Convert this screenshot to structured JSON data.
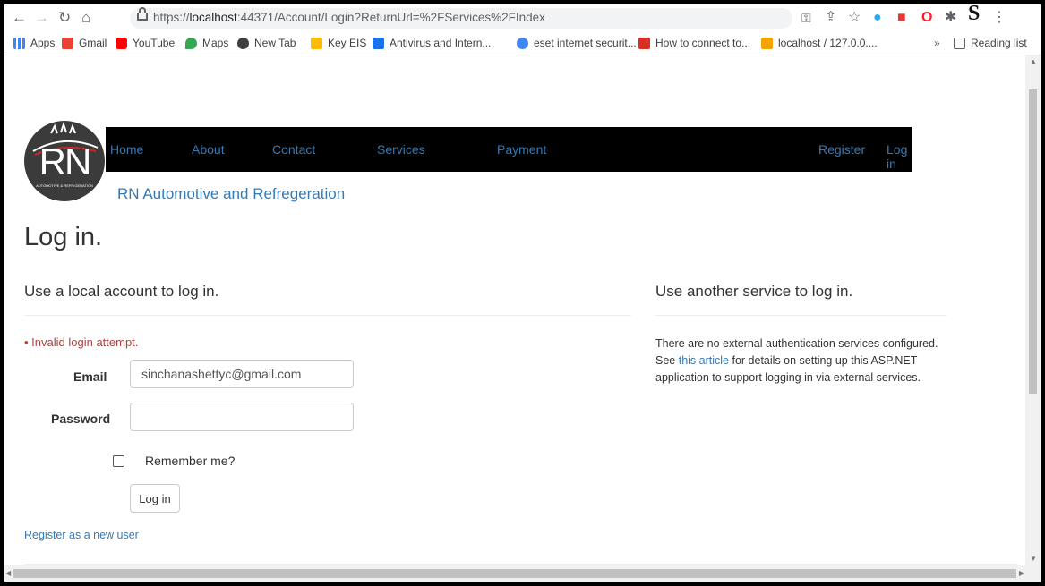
{
  "browser": {
    "url_prefix": "https://",
    "url_host": "localhost",
    "url_rest": ":44371/Account/Login?ReturnUrl=%2FServices%2FIndex",
    "profile_letter": "S"
  },
  "bookmarks": [
    {
      "label": "Apps",
      "color": "#4285f4"
    },
    {
      "label": "Gmail",
      "color": "#ea4335"
    },
    {
      "label": "YouTube",
      "color": "#ff0000"
    },
    {
      "label": "Maps",
      "color": "#34a853"
    },
    {
      "label": "New Tab",
      "color": "#3c4043"
    },
    {
      "label": "Key EIS",
      "color": "#fbbc05"
    },
    {
      "label": "Antivirus and Intern...",
      "color": "#1a73e8"
    },
    {
      "label": "eset internet securit...",
      "color": "#4285f4"
    },
    {
      "label": "How to connect to...",
      "color": "#d93025"
    },
    {
      "label": "localhost / 127.0.0....",
      "color": "#f4a300"
    }
  ],
  "reading_list": "Reading list",
  "overflow": "»",
  "logo": {
    "initials": "RN",
    "tagline": "AUTOMOTIVE & REFRIGERATION"
  },
  "nav": {
    "home": "Home",
    "about": "About",
    "contact": "Contact",
    "services": "Services",
    "payment": "Payment",
    "register": "Register",
    "login": "Log in"
  },
  "brand": "RN Automotive and Refregeration",
  "page_title": "Log in.",
  "local": {
    "heading": "Use a local account to log in.",
    "error": "Invalid login attempt.",
    "email_label": "Email",
    "email_value": "sinchanashettyc@gmail.com",
    "password_label": "Password",
    "password_value": "",
    "remember_label": "Remember me?",
    "login_button": "Log in",
    "register_link": "Register as a new user"
  },
  "external": {
    "heading": "Use another service to log in.",
    "line1": "There are no external authentication services configured.",
    "see": "See",
    "article_link": "this article",
    "rest": "for details on setting up this ASP.NET application to support logging in via external services."
  }
}
